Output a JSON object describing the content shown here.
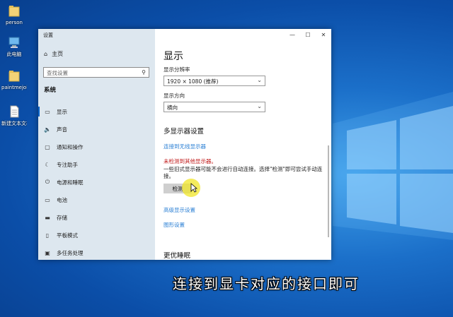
{
  "desktop": {
    "icons": [
      {
        "label": "person",
        "icon": "folder-icon"
      },
      {
        "label": "此电脑",
        "icon": "computer-icon"
      },
      {
        "label": "paintmejob",
        "icon": "folder-icon"
      },
      {
        "label": "新建文本文档",
        "icon": "file-icon"
      }
    ]
  },
  "window": {
    "title": "设置",
    "controls": {
      "minimize": "—",
      "maximize": "☐",
      "close": "✕"
    }
  },
  "sidebar": {
    "home": "主页",
    "search_placeholder": "查找设置",
    "section": "系统",
    "items": [
      {
        "label": "显示",
        "icon": "monitor-icon",
        "glyph": "▭"
      },
      {
        "label": "声音",
        "icon": "speaker-icon",
        "glyph": "🔈"
      },
      {
        "label": "通知和操作",
        "icon": "notification-icon",
        "glyph": "▢"
      },
      {
        "label": "专注助手",
        "icon": "moon-icon",
        "glyph": "☾"
      },
      {
        "label": "电源和睡眠",
        "icon": "power-icon",
        "glyph": "⏻"
      },
      {
        "label": "电池",
        "icon": "battery-icon",
        "glyph": "▭"
      },
      {
        "label": "存储",
        "icon": "storage-icon",
        "glyph": "▬"
      },
      {
        "label": "平板模式",
        "icon": "tablet-icon",
        "glyph": "▯"
      },
      {
        "label": "多任务处理",
        "icon": "multitask-icon",
        "glyph": "▣"
      }
    ]
  },
  "main": {
    "title": "显示",
    "resolution_label": "显示分辨率",
    "resolution_value": "1920 × 1080 (推荐)",
    "orientation_label": "显示方向",
    "orientation_value": "横向",
    "multi_display_heading": "多显示器设置",
    "connect_wireless_link": "连接到无线显示器",
    "error_text": "未检测到其他显示器。",
    "description": "一些旧式显示器可能不会进行自动连接。选择\"检测\"即可尝试手动连接。",
    "detect_button": "检测",
    "advanced_link": "高级显示设置",
    "graphics_link": "图形设置",
    "sleep_heading": "更优睡眠"
  },
  "subtitle": "连接到显卡对应的接口即可",
  "colors": {
    "accent": "#2a7fd4",
    "error": "#c01818",
    "sidebar_bg": "#dde7ef",
    "highlight": "#f0e628"
  }
}
